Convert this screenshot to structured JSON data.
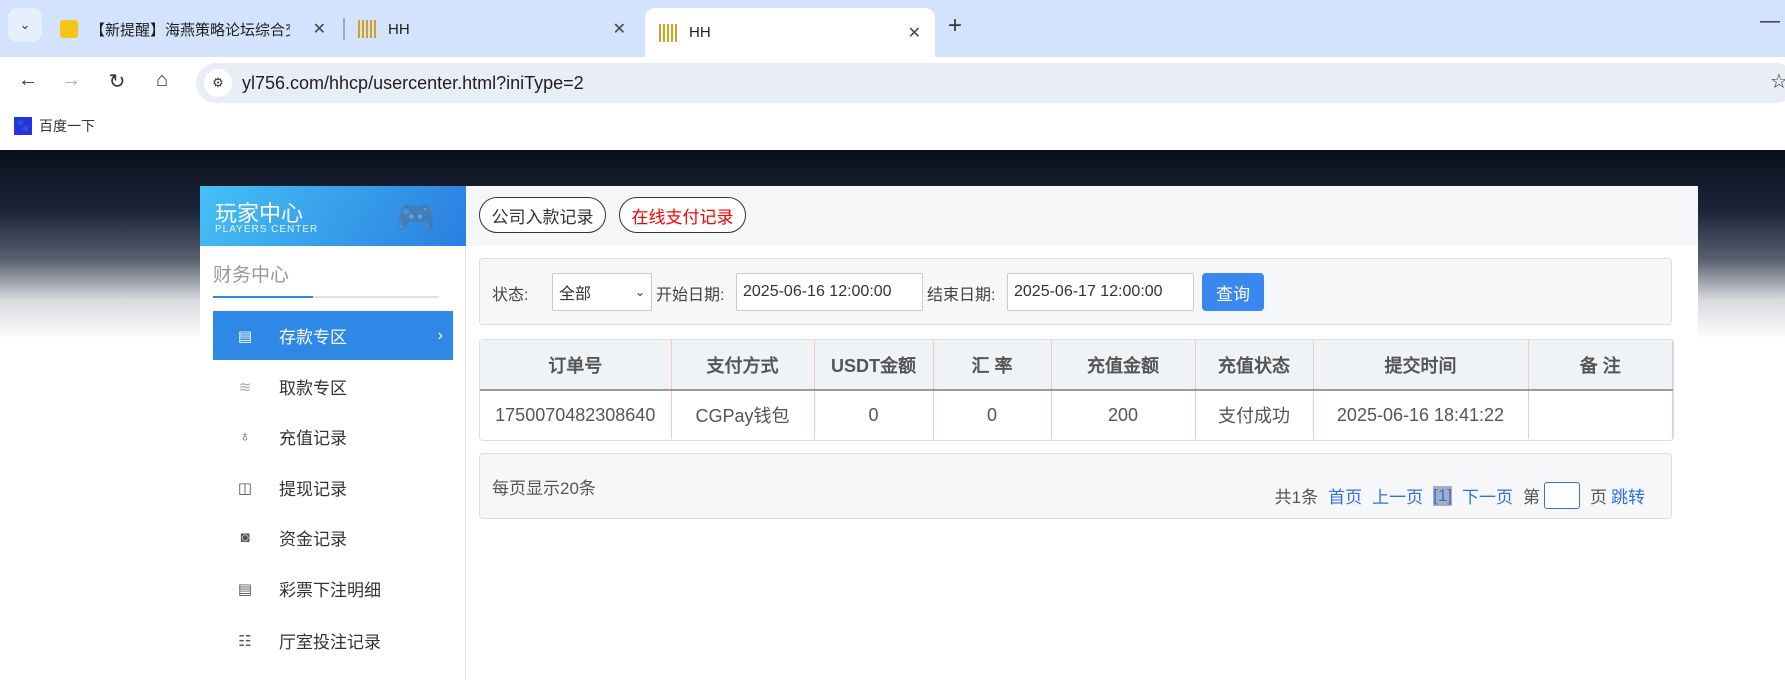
{
  "browser": {
    "tabs": [
      {
        "title": "【新提醒】海燕策略论坛综合交",
        "active": false
      },
      {
        "title": "HH",
        "active": false
      },
      {
        "title": "HH",
        "active": true
      }
    ],
    "url": "yl756.com/hhcp/usercenter.html?iniType=2",
    "bookmarks": [
      {
        "label": "百度一下"
      }
    ]
  },
  "sidebar": {
    "header_title": "玩家中心",
    "header_subtitle": "PLAYERS CENTER",
    "section": "财务中心",
    "items": [
      {
        "label": "存款专区",
        "icon": "card-icon",
        "active": true
      },
      {
        "label": "取款专区",
        "icon": "hand-money-icon"
      },
      {
        "label": "充值记录",
        "icon": "money-bag-icon"
      },
      {
        "label": "提现记录",
        "icon": "wallet-icon"
      },
      {
        "label": "资金记录",
        "icon": "cash-icon"
      },
      {
        "label": "彩票下注明细",
        "icon": "list-icon"
      },
      {
        "label": "厅室投注记录",
        "icon": "grid-list-icon"
      }
    ]
  },
  "main": {
    "tabs": [
      {
        "label": "公司入款记录",
        "active": false
      },
      {
        "label": "在线支付记录",
        "active": true
      }
    ],
    "filter": {
      "status_label": "状态:",
      "status_value": "全部",
      "start_label": "开始日期:",
      "start_value": "2025-06-16 12:00:00",
      "end_label": "结束日期:",
      "end_value": "2025-06-17 12:00:00",
      "query_label": "查询"
    },
    "table": {
      "columns": [
        "订单号",
        "支付方式",
        "USDT金额",
        "汇 率",
        "充值金额",
        "充值状态",
        "提交时间",
        "备 注"
      ],
      "rows": [
        [
          "1750070482308640",
          "CGPay钱包",
          "0",
          "0",
          "200",
          "支付成功",
          "2025-06-16 18:41:22",
          ""
        ]
      ]
    },
    "pagination": {
      "per_page": "每页显示20条",
      "total": "共1条",
      "first": "首页",
      "prev": "上一页",
      "current": "[1]",
      "next": "下一页",
      "page_prefix": "第",
      "page_suffix": "页",
      "jump": "跳转"
    }
  },
  "colors": {
    "accent": "#2e88e6",
    "active_tab_text": "#ff0000",
    "link": "#2f6fe0"
  }
}
